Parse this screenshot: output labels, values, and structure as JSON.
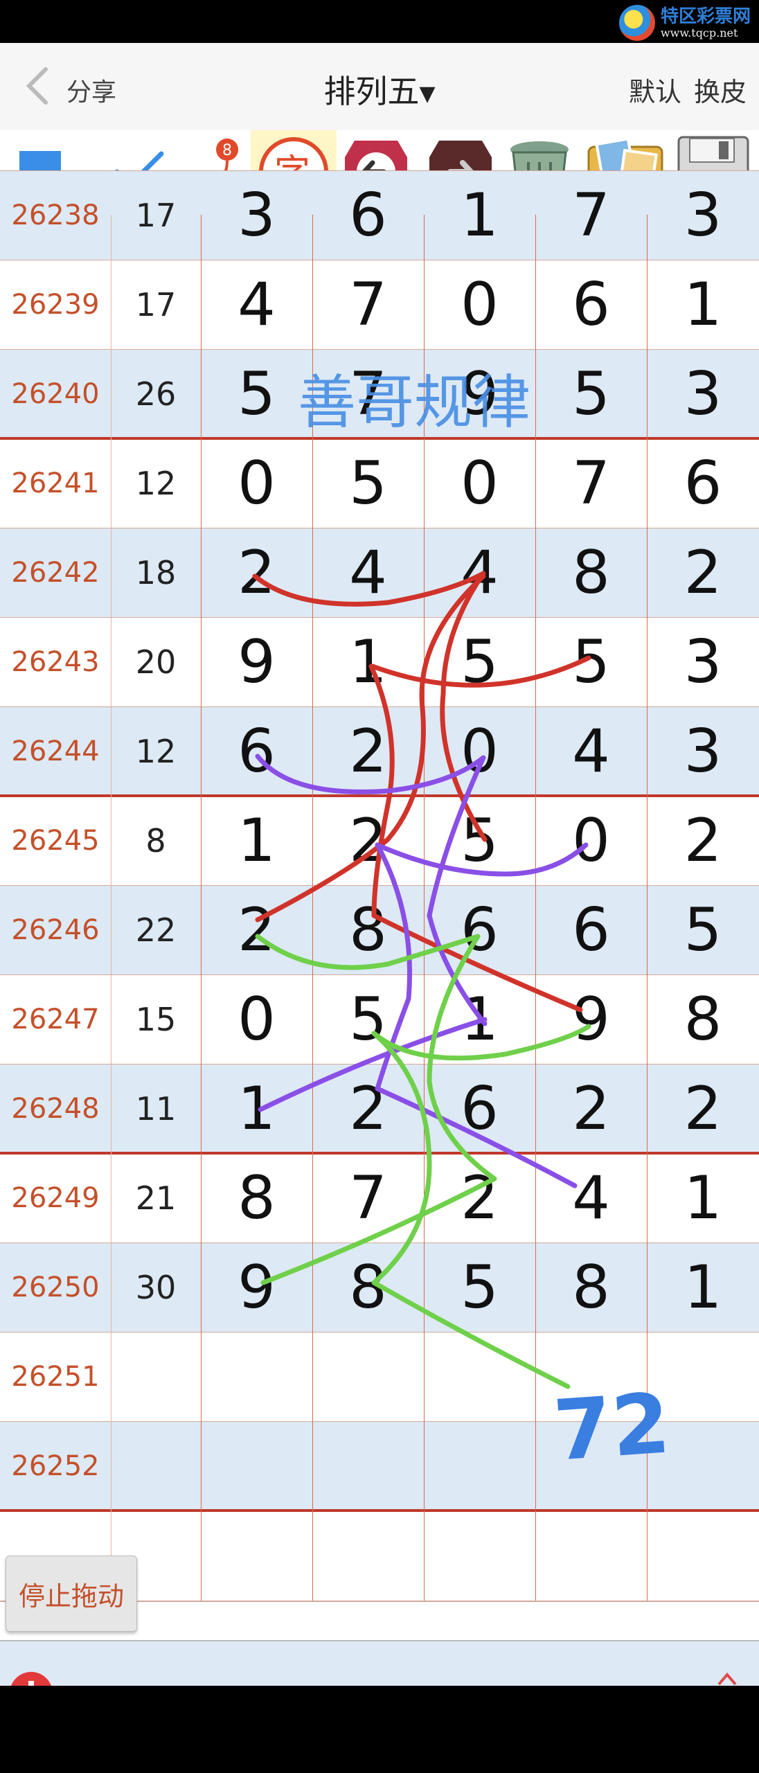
{
  "watermark": {
    "title": "特区彩票网",
    "url": "www.tqcp.net"
  },
  "header": {
    "back_label": "分享",
    "title": "排列五",
    "actions": [
      "默认",
      "换皮"
    ]
  },
  "toolbar": {
    "icons": [
      "square-tool",
      "check-pen-tool",
      "number-pen-tool",
      "zi-tool",
      "left-arrow-tool",
      "right-arrow-tool",
      "trash-tool",
      "picture-tool",
      "save-tool"
    ]
  },
  "overlay": {
    "caption": "善哥规律",
    "handwritten": "72"
  },
  "table": {
    "rows": [
      {
        "id": "26238",
        "sum": "17",
        "digits": [
          "3",
          "6",
          "1",
          "7",
          "3"
        ]
      },
      {
        "id": "26239",
        "sum": "17",
        "digits": [
          "4",
          "7",
          "0",
          "6",
          "1"
        ]
      },
      {
        "id": "26240",
        "sum": "26",
        "digits": [
          "5",
          "7",
          "9",
          "5",
          "3"
        ]
      },
      {
        "id": "26241",
        "sum": "12",
        "digits": [
          "0",
          "5",
          "0",
          "7",
          "6"
        ]
      },
      {
        "id": "26242",
        "sum": "18",
        "digits": [
          "2",
          "4",
          "4",
          "8",
          "2"
        ]
      },
      {
        "id": "26243",
        "sum": "20",
        "digits": [
          "9",
          "1",
          "5",
          "5",
          "3"
        ]
      },
      {
        "id": "26244",
        "sum": "12",
        "digits": [
          "6",
          "2",
          "0",
          "4",
          "3"
        ]
      },
      {
        "id": "26245",
        "sum": "8",
        "digits": [
          "1",
          "2",
          "5",
          "0",
          "2"
        ]
      },
      {
        "id": "26246",
        "sum": "22",
        "digits": [
          "2",
          "8",
          "6",
          "6",
          "5"
        ]
      },
      {
        "id": "26247",
        "sum": "15",
        "digits": [
          "0",
          "5",
          "1",
          "9",
          "8"
        ]
      },
      {
        "id": "26248",
        "sum": "11",
        "digits": [
          "1",
          "2",
          "6",
          "2",
          "2"
        ]
      },
      {
        "id": "26249",
        "sum": "21",
        "digits": [
          "8",
          "7",
          "2",
          "4",
          "1"
        ]
      },
      {
        "id": "26250",
        "sum": "30",
        "digits": [
          "9",
          "8",
          "5",
          "8",
          "1"
        ]
      },
      {
        "id": "26251",
        "sum": "",
        "digits": [
          "",
          "",
          "",
          "",
          ""
        ]
      },
      {
        "id": "26252",
        "sum": "",
        "digits": [
          "",
          "",
          "",
          "",
          ""
        ]
      }
    ]
  },
  "stop_drag_label": "停止拖动",
  "colors": {
    "accent_red": "#c0392b",
    "row_alt": "#dde9f5",
    "id_text": "#c4502a",
    "stroke_red": "#d0332a",
    "stroke_purple": "#8a4fe6",
    "stroke_green": "#6fd04a"
  }
}
